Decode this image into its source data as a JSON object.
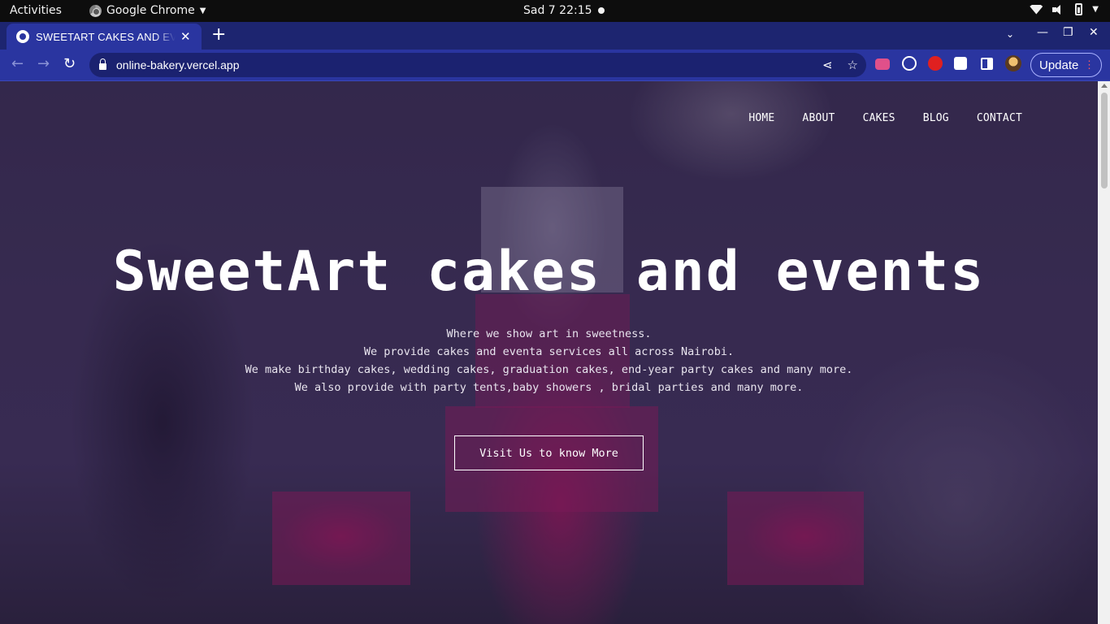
{
  "system_bar": {
    "activities": "Activities",
    "app_name": "Google Chrome",
    "clock": "Sad 7  22:15"
  },
  "browser": {
    "tab_title": "SWEETART CAKES AND EVENTS",
    "url": "online-bakery.vercel.app",
    "update_label": "Update",
    "colors": {
      "tab_bar": "#1d2570",
      "toolbar": "#2a35a0"
    }
  },
  "site": {
    "nav": [
      "HOME",
      "ABOUT",
      "CAKES",
      "BLOG",
      "CONTACT"
    ],
    "hero_title": "SweetArt cakes and events",
    "hero_lines": [
      "Where we show art in sweetness.",
      "We provide cakes and eventa services all across Nairobi.",
      "We make birthday cakes, wedding cakes, graduation cakes, end-year party cakes and many more.",
      "We also provide with party tents,baby showers , bridal parties and many more."
    ],
    "cta_label": "Visit Us to know More",
    "colors": {
      "cake_accent": "#b0145a",
      "overlay": "#28194a"
    }
  }
}
